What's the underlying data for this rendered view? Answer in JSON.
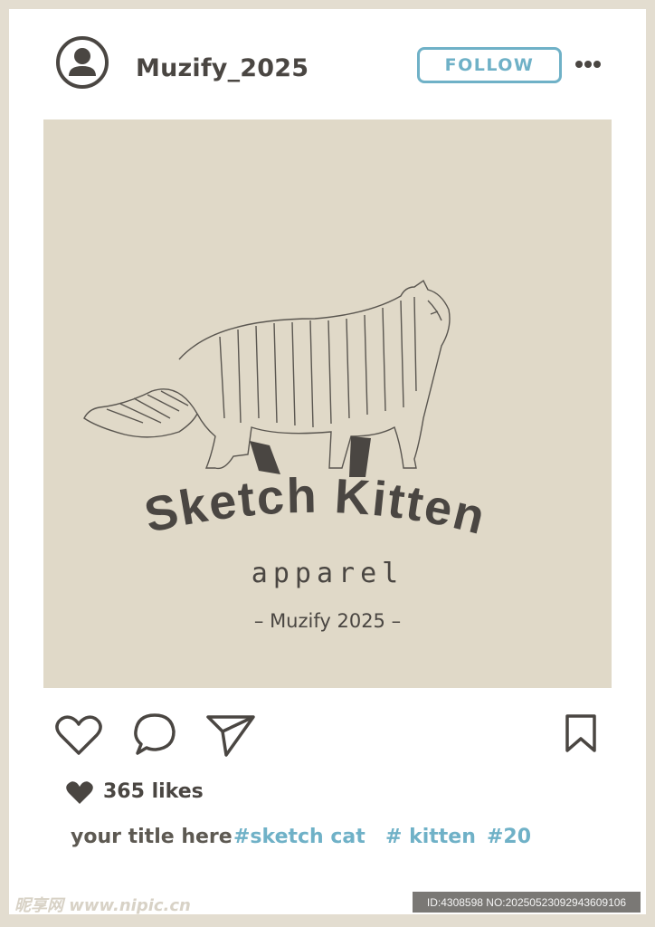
{
  "header": {
    "username": "Muzify_2025",
    "follow_label": "FOLLOW"
  },
  "post": {
    "logo_title": "Sketch Kitten",
    "logo_subtitle": "apparel",
    "logo_brand": "– Muzify 2025 –"
  },
  "actions": {
    "like": "heart-icon",
    "comment": "comment-icon",
    "share": "send-icon",
    "save": "bookmark-icon"
  },
  "likes": {
    "text": "365 likes"
  },
  "caption": {
    "title": "your title here",
    "hashtags": [
      "#sketch cat",
      "# kitten",
      "#20"
    ]
  },
  "watermark": {
    "site": "昵享网 www.nipic.cn",
    "id_text": "ID:4308598 NO:20250523092943609106"
  },
  "colors": {
    "accent": "#6fb1c7",
    "text": "#4a4642",
    "frame": "#e3ddd0",
    "image_bg": "#e0d9c8"
  }
}
